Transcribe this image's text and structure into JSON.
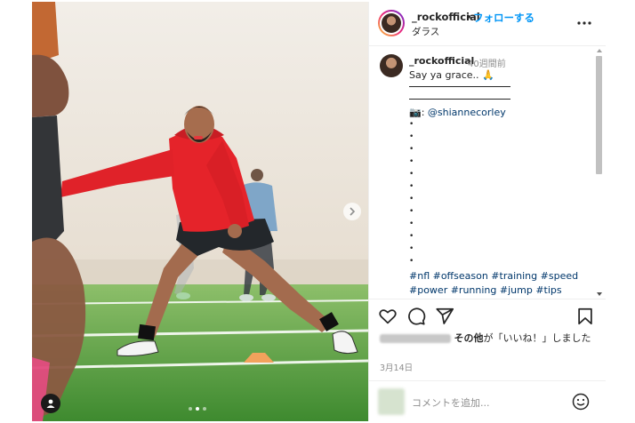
{
  "post": {
    "username": "_rockofficial",
    "separator": "•",
    "follow_label": "フォローする",
    "location": "ダラス",
    "caption": {
      "time": "40週間前",
      "text": "Say ya grace.. 🙏",
      "mention_prefix": "📷: ",
      "mention": "@shiannecorley",
      "bullet": "•",
      "hashtags_line1": "#nfl #offseason #training #speed",
      "hashtags_line2": "#power #running #jump #tips #trainer"
    },
    "likes_suffix_bold": "その他",
    "likes_suffix": "が「いいね！」しました",
    "date": "3月14日",
    "comment_placeholder": "コメントを追加..."
  },
  "icons": {
    "more": "more-options-icon",
    "heart": "heart-icon",
    "comment": "comment-icon",
    "share": "share-icon",
    "save": "bookmark-icon",
    "emoji": "emoji-icon",
    "next": "chevron-right-icon",
    "tag": "user-tag-icon"
  },
  "colors": {
    "link": "#00376b",
    "follow": "#0095f6",
    "hoodie": "#e5232a"
  },
  "carousel": {
    "current": 2,
    "total": 3
  }
}
